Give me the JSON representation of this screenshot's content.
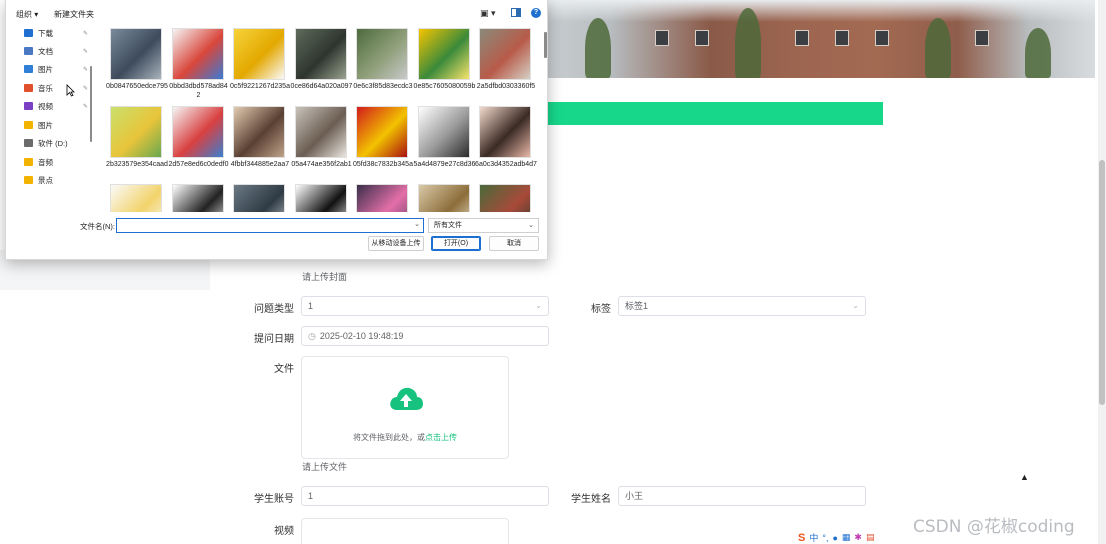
{
  "dialog": {
    "toolbar": {
      "organize": "组织 ▾",
      "new_folder": "新建文件夹",
      "view": "▣ ▾",
      "help": "?"
    },
    "nav_items": [
      {
        "label": "下载",
        "icon": "download-icon",
        "color": "#1f6fd1",
        "pinned": true
      },
      {
        "label": "文档",
        "icon": "document-icon",
        "color": "#4a78c2",
        "pinned": true
      },
      {
        "label": "图片",
        "icon": "pictures-icon",
        "color": "#2f7fd6",
        "pinned": true
      },
      {
        "label": "音乐",
        "icon": "music-icon",
        "color": "#e0502b",
        "pinned": true
      },
      {
        "label": "视频",
        "icon": "video-icon",
        "color": "#7a3fc2",
        "pinned": true
      },
      {
        "label": "图片",
        "icon": "folder-icon",
        "color": "#f2b400",
        "pinned": false
      },
      {
        "label": "软件 (D:)",
        "icon": "drive-icon",
        "color": "#6b6b6b",
        "pinned": false
      },
      {
        "label": "音频",
        "icon": "folder-icon",
        "color": "#f2b400",
        "pinned": false
      },
      {
        "label": "景点",
        "icon": "folder-icon",
        "color": "#f2b400",
        "pinned": false
      }
    ],
    "files": [
      {
        "name": "0b0847650edce795",
        "colors": [
          "#7b8a9a",
          "#3d4b5c",
          "#a9b3bd"
        ]
      },
      {
        "name": "0bbd3dbd578ad842",
        "colors": [
          "#f4f4f4",
          "#d9463b",
          "#3a7bd5"
        ]
      },
      {
        "name": "0c5f9221267d235a",
        "colors": [
          "#f6d33a",
          "#e3a800",
          "#fafafa"
        ]
      },
      {
        "name": "0ce86d64a020a097",
        "colors": [
          "#5e6b5a",
          "#2e3530",
          "#9aa48e"
        ]
      },
      {
        "name": "0e6c3f85d83ecdc3",
        "colors": [
          "#4f6b3e",
          "#8f9f7a",
          "#c9c9c9"
        ]
      },
      {
        "name": "0e85c7605080059b",
        "colors": [
          "#f5c400",
          "#3b8a3b",
          "#f8e36b"
        ]
      },
      {
        "name": "2a5dfbd0303360f5",
        "colors": [
          "#8a8a7a",
          "#b85b4a",
          "#d5d0c4"
        ]
      },
      {
        "name": "2b323579e354caad",
        "colors": [
          "#c9e06b",
          "#e8c43a",
          "#6aa84f"
        ]
      },
      {
        "name": "2d57e8ed6c0dedf0",
        "colors": [
          "#f5f5f5",
          "#d94040",
          "#3b7fd0"
        ]
      },
      {
        "name": "4fbbf344885e2aa7",
        "colors": [
          "#e2cbb0",
          "#5a4033",
          "#bfa38a"
        ]
      },
      {
        "name": "05a474ae356f2ab1",
        "colors": [
          "#c8c3bb",
          "#6b5d52",
          "#e9e5df"
        ]
      },
      {
        "name": "05fd38c7832b345a",
        "colors": [
          "#d21c1c",
          "#f2c200",
          "#a81010"
        ]
      },
      {
        "name": "5a4d4879e27c8d36",
        "colors": [
          "#ffffff",
          "#9a9a9a",
          "#2b2b2b"
        ]
      },
      {
        "name": "6a0c3d4352adb4d7",
        "colors": [
          "#f3d9cc",
          "#3a2a24",
          "#e8b8a8"
        ]
      },
      {
        "name": "",
        "colors": [
          "#fafafa",
          "#f2d36b",
          "#fafafa"
        ]
      },
      {
        "name": "",
        "colors": [
          "#ffffff",
          "#222222",
          "#ffffff"
        ]
      },
      {
        "name": "",
        "colors": [
          "#6b7a85",
          "#2e3a44",
          "#c8cdd2"
        ]
      },
      {
        "name": "",
        "colors": [
          "#ffffff",
          "#111111",
          "#ffffff"
        ]
      },
      {
        "name": "",
        "colors": [
          "#3a2f4a",
          "#e36fa8",
          "#6b3f6a"
        ]
      },
      {
        "name": "",
        "colors": [
          "#d8c9a8",
          "#8c6d3a",
          "#f0e8d0"
        ]
      },
      {
        "name": "",
        "colors": [
          "#4b6a3a",
          "#a84a3a",
          "#2e3a2a"
        ]
      }
    ],
    "filename_label": "文件名(N):",
    "filename_value": "",
    "file_type": "所有文件",
    "btn_mobile": "从移动设备上传",
    "btn_open": "打开(O)",
    "btn_cancel": "取消"
  },
  "form": {
    "cover_hint": "请上传封面",
    "question_type_label": "问题类型",
    "question_type_value": "1",
    "tag_label": "标签",
    "tag_value": "标签1",
    "date_label": "提问日期",
    "date_value": "2025-02-10 19:48:19",
    "file_label": "文件",
    "upload_text": "将文件拖到此处，或",
    "upload_link": "点击上传",
    "file_hint": "请上传文件",
    "student_account_label": "学生账号",
    "student_account_value": "1",
    "student_name_label": "学生姓名",
    "student_name_value": "小王",
    "video_label": "视频",
    "accent": "#17d78b"
  },
  "watermark": "CSDN @花椒coding",
  "ime": {
    "label": "中",
    "logo": "S"
  }
}
